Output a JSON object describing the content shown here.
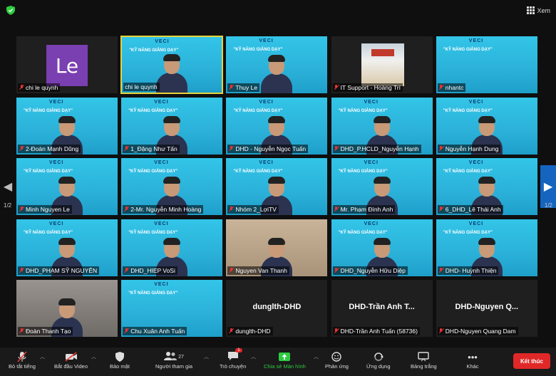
{
  "header": {
    "view_label": "Xem"
  },
  "pagination": {
    "left": "1/2",
    "right": "1/2"
  },
  "slide": {
    "logo": "VECI",
    "title": "\"KỸ NĂNG GIẢNG DẠY\"",
    "subtitle": "Khóa đào tạo trực tuyến"
  },
  "tiles": [
    {
      "name": "chi le quynh",
      "type": "le",
      "mic": "off",
      "avatar_text": "Le"
    },
    {
      "name": "chi le quynh",
      "type": "slide-person",
      "mic": "none",
      "active": true
    },
    {
      "name": "Thuy Le",
      "type": "slide-person",
      "mic": "off"
    },
    {
      "name": "IT Support - Hoàng Trí",
      "type": "building",
      "mic": "off"
    },
    {
      "name": "nhantc",
      "type": "slide",
      "mic": "off"
    },
    {
      "name": "2-Đoàn Mạnh Dũng",
      "type": "slide-person",
      "mic": "off"
    },
    {
      "name": "1_Đặng Như Tấn",
      "type": "slide-person",
      "mic": "off"
    },
    {
      "name": "DHD - Nguyễn Ngọc Tuấn",
      "type": "slide-person",
      "mic": "off"
    },
    {
      "name": "DHD_P.HCLD_Nguyễn Hạnh",
      "type": "slide-person",
      "mic": "off"
    },
    {
      "name": "Nguyễn Hạnh Dung",
      "type": "slide-person",
      "mic": "off"
    },
    {
      "name": "Minh Nguyen Le",
      "type": "slide-person",
      "mic": "off"
    },
    {
      "name": "2-Mr. Nguyễn Minh Hoàng",
      "type": "slide-person",
      "mic": "off"
    },
    {
      "name": "Nhóm 2_LợiTV",
      "type": "slide-person",
      "mic": "off"
    },
    {
      "name": "Mr. Phạm Đình Anh",
      "type": "slide-person",
      "mic": "off"
    },
    {
      "name": "6_DHD_Lê Thái Anh",
      "type": "slide-person",
      "mic": "off"
    },
    {
      "name": "DHD_PHẠM SỸ NGUYÊN",
      "type": "slide-person",
      "mic": "off"
    },
    {
      "name": "DHD_HIEP VoSi",
      "type": "slide-person",
      "mic": "off"
    },
    {
      "name": "Nguyen Van Thanh",
      "type": "room-person",
      "mic": "off"
    },
    {
      "name": "DHD_Nguyễn Hữu Diệp",
      "type": "slide-person",
      "mic": "off"
    },
    {
      "name": "DHD- Huỳnh Thiện",
      "type": "slide-person",
      "mic": "off"
    },
    {
      "name": "Đoàn Thanh Tạo",
      "type": "room2-person",
      "mic": "off"
    },
    {
      "name": "Chu Xuân Anh Tuấn",
      "type": "slide-person-small",
      "mic": "off"
    },
    {
      "name": "dunglth-DHD",
      "type": "name",
      "mic": "off",
      "display": "dunglth-DHD"
    },
    {
      "name": "DHD-Trần Anh Tuấn (58736)",
      "type": "name",
      "mic": "off",
      "display": "DHD-Trần Anh T..."
    },
    {
      "name": "DHD-Nguyen Quang Dam",
      "type": "name",
      "mic": "off",
      "display": "DHD-Nguyen Q..."
    }
  ],
  "toolbar": {
    "mute": "Bỏ tắt tiếng",
    "video": "Bắt đầu Video",
    "security": "Bảo mật",
    "participants": "Người tham gia",
    "participants_count": "27",
    "chat": "Trò chuyện",
    "chat_badge": "1",
    "share": "Chia sẻ Màn hình",
    "reactions": "Phản ứng",
    "apps": "Ứng dụng",
    "whiteboard": "Bảng trắng",
    "more": "Khác",
    "end": "Kết thúc"
  },
  "colors": {
    "active_border": "#e5d33a",
    "end_button": "#e02828",
    "share_green": "#2ecc40",
    "nav_active": "#1565c0"
  }
}
